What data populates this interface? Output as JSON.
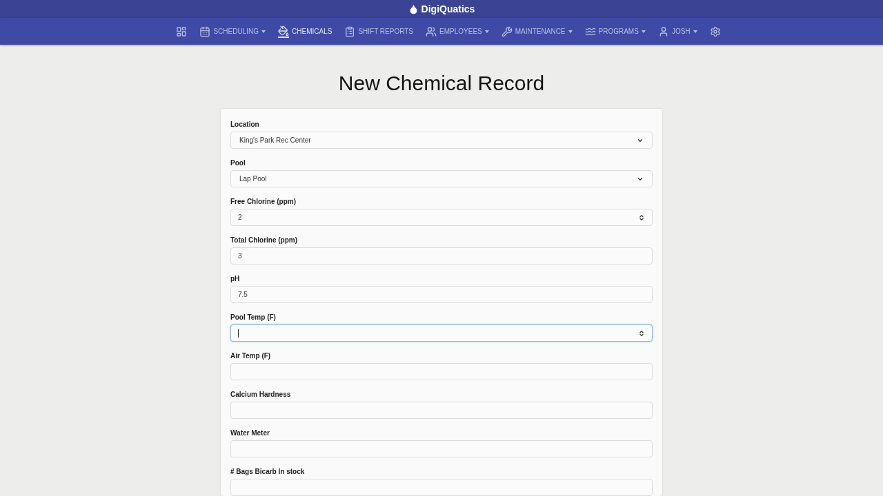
{
  "brand": {
    "name": "DigiQuatics"
  },
  "nav": [
    {
      "kind": "dashboard",
      "active": false
    },
    {
      "kind": "calendar",
      "label": "SCHEDULING",
      "dropdown": true,
      "active": false
    },
    {
      "kind": "chemicals",
      "label": "CHEMICALS",
      "active": true
    },
    {
      "kind": "clipboard",
      "label": "SHIFT REPORTS",
      "active": false
    },
    {
      "kind": "people",
      "label": "EMPLOYEES",
      "dropdown": true,
      "active": false
    },
    {
      "kind": "wrench",
      "label": "MAINTENANCE",
      "dropdown": true,
      "active": false
    },
    {
      "kind": "swimmer",
      "label": "PROGRAMS",
      "dropdown": true,
      "active": false
    },
    {
      "kind": "person",
      "label": "JOSH",
      "dropdown": true,
      "active": false
    },
    {
      "kind": "settings",
      "active": false
    }
  ],
  "page_title": "New Chemical Record",
  "fields": [
    {
      "label": "Location",
      "kind": "select",
      "value": "King's Park Rec Center",
      "focused": false
    },
    {
      "label": "Pool",
      "kind": "select",
      "value": "Lap Pool",
      "focused": false
    },
    {
      "label": "Free Chlorine (ppm)",
      "kind": "number",
      "value": "2",
      "focused": false
    },
    {
      "label": "Total Chlorine (ppm)",
      "kind": "text",
      "value": "3",
      "focused": false
    },
    {
      "label": "pH",
      "kind": "text",
      "value": "7.5",
      "focused": false
    },
    {
      "label": "Pool Temp (F)",
      "kind": "number",
      "focused": true
    },
    {
      "label": "Air Temp (F)",
      "kind": "text",
      "focused": false
    },
    {
      "label": "Calcium Hardness",
      "kind": "text",
      "focused": false
    },
    {
      "label": "Water Meter",
      "kind": "text",
      "focused": false
    },
    {
      "label": "# Bags Bicarb In stock",
      "kind": "text",
      "focused": false
    }
  ]
}
